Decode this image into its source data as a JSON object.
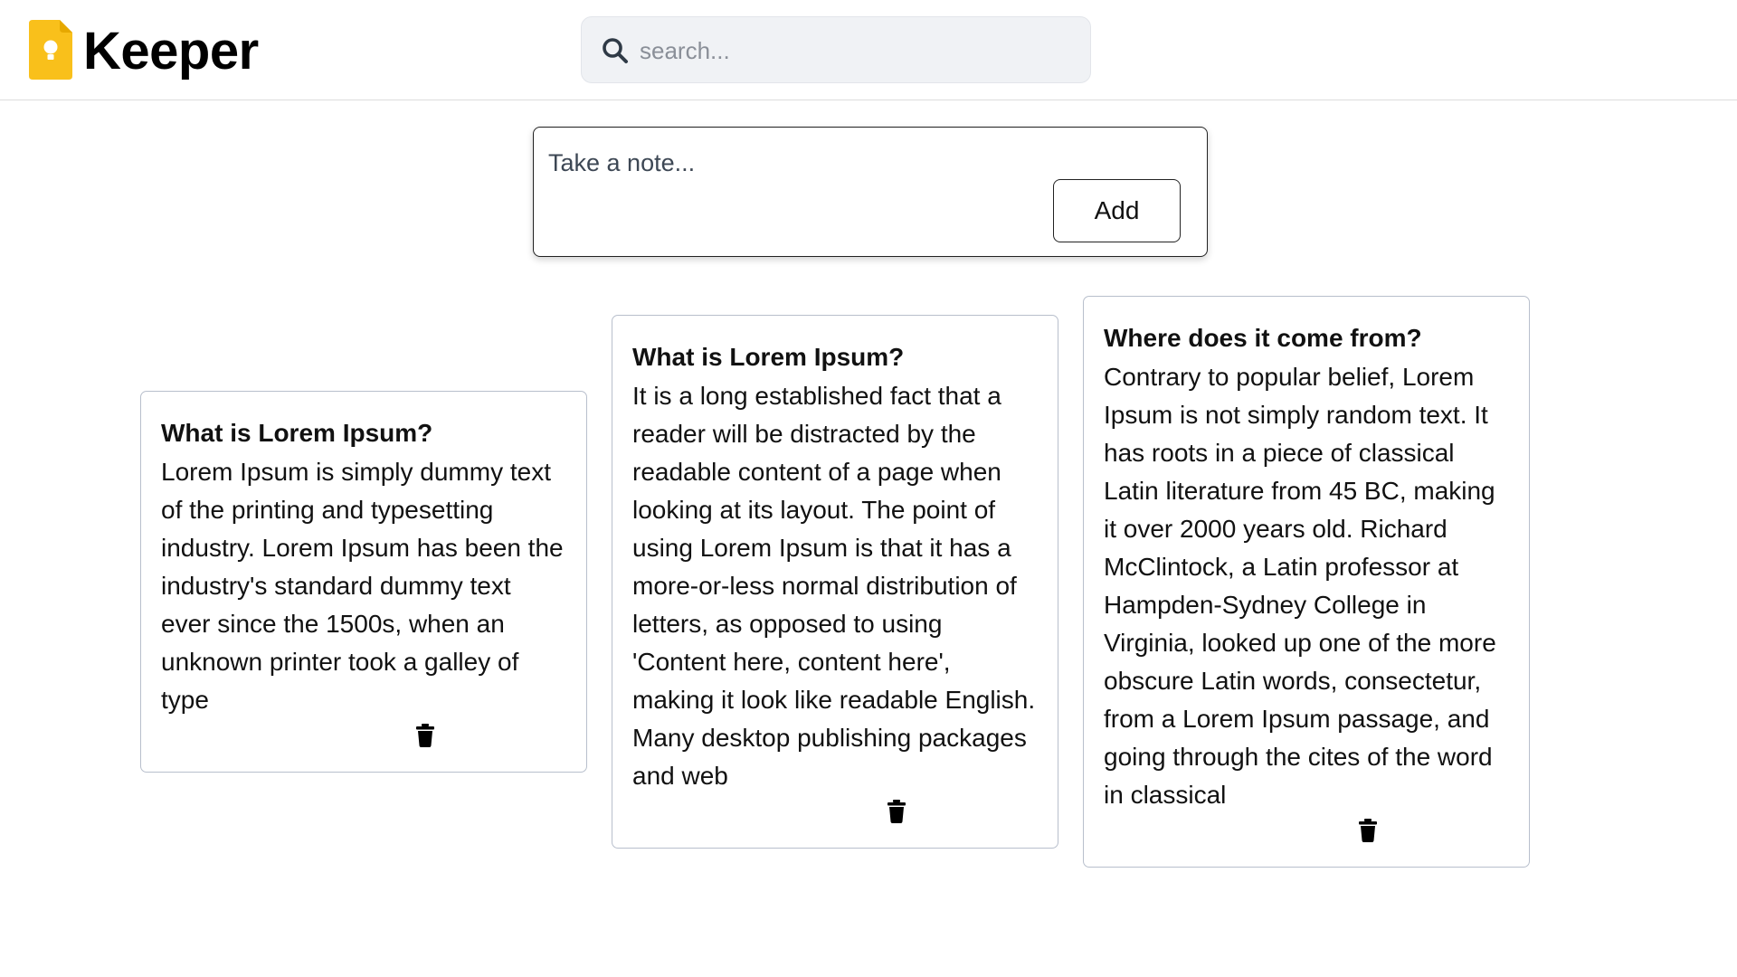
{
  "header": {
    "app_name": "Keeper",
    "logo_icon": "lightbulb-note-icon",
    "brand_color": "#f9c01b",
    "search": {
      "icon": "search-icon",
      "placeholder": "search..."
    }
  },
  "composer": {
    "placeholder": "Take a note...",
    "add_label": "Add"
  },
  "notes": [
    {
      "title": "What is Lorem Ipsum?",
      "content": "Lorem Ipsum is simply dummy text of the printing and typesetting industry. Lorem Ipsum has been the industry's standard dummy text ever since the 1500s, when an unknown printer took a galley of type",
      "delete_icon": "trash-icon"
    },
    {
      "title": "What is Lorem Ipsum?",
      "content": "It is a long established fact that a reader will be distracted by the readable content of a page when looking at its layout. The point of using Lorem Ipsum is that it has a more-or-less normal distribution of letters, as opposed to using 'Content here, content here', making it look like readable English. Many desktop publishing packages and web",
      "delete_icon": "trash-icon"
    },
    {
      "title": "Where does it come from?",
      "content": "Contrary to popular belief, Lorem Ipsum is not simply random text. It has roots in a piece of classical Latin literature from 45 BC, making it over 2000 years old. Richard McClintock, a Latin professor at Hampden-Sydney College in Virginia, looked up one of the more obscure Latin words, consectetur, from a Lorem Ipsum passage, and going through the cites of the word in classical",
      "delete_icon": "trash-icon"
    }
  ]
}
